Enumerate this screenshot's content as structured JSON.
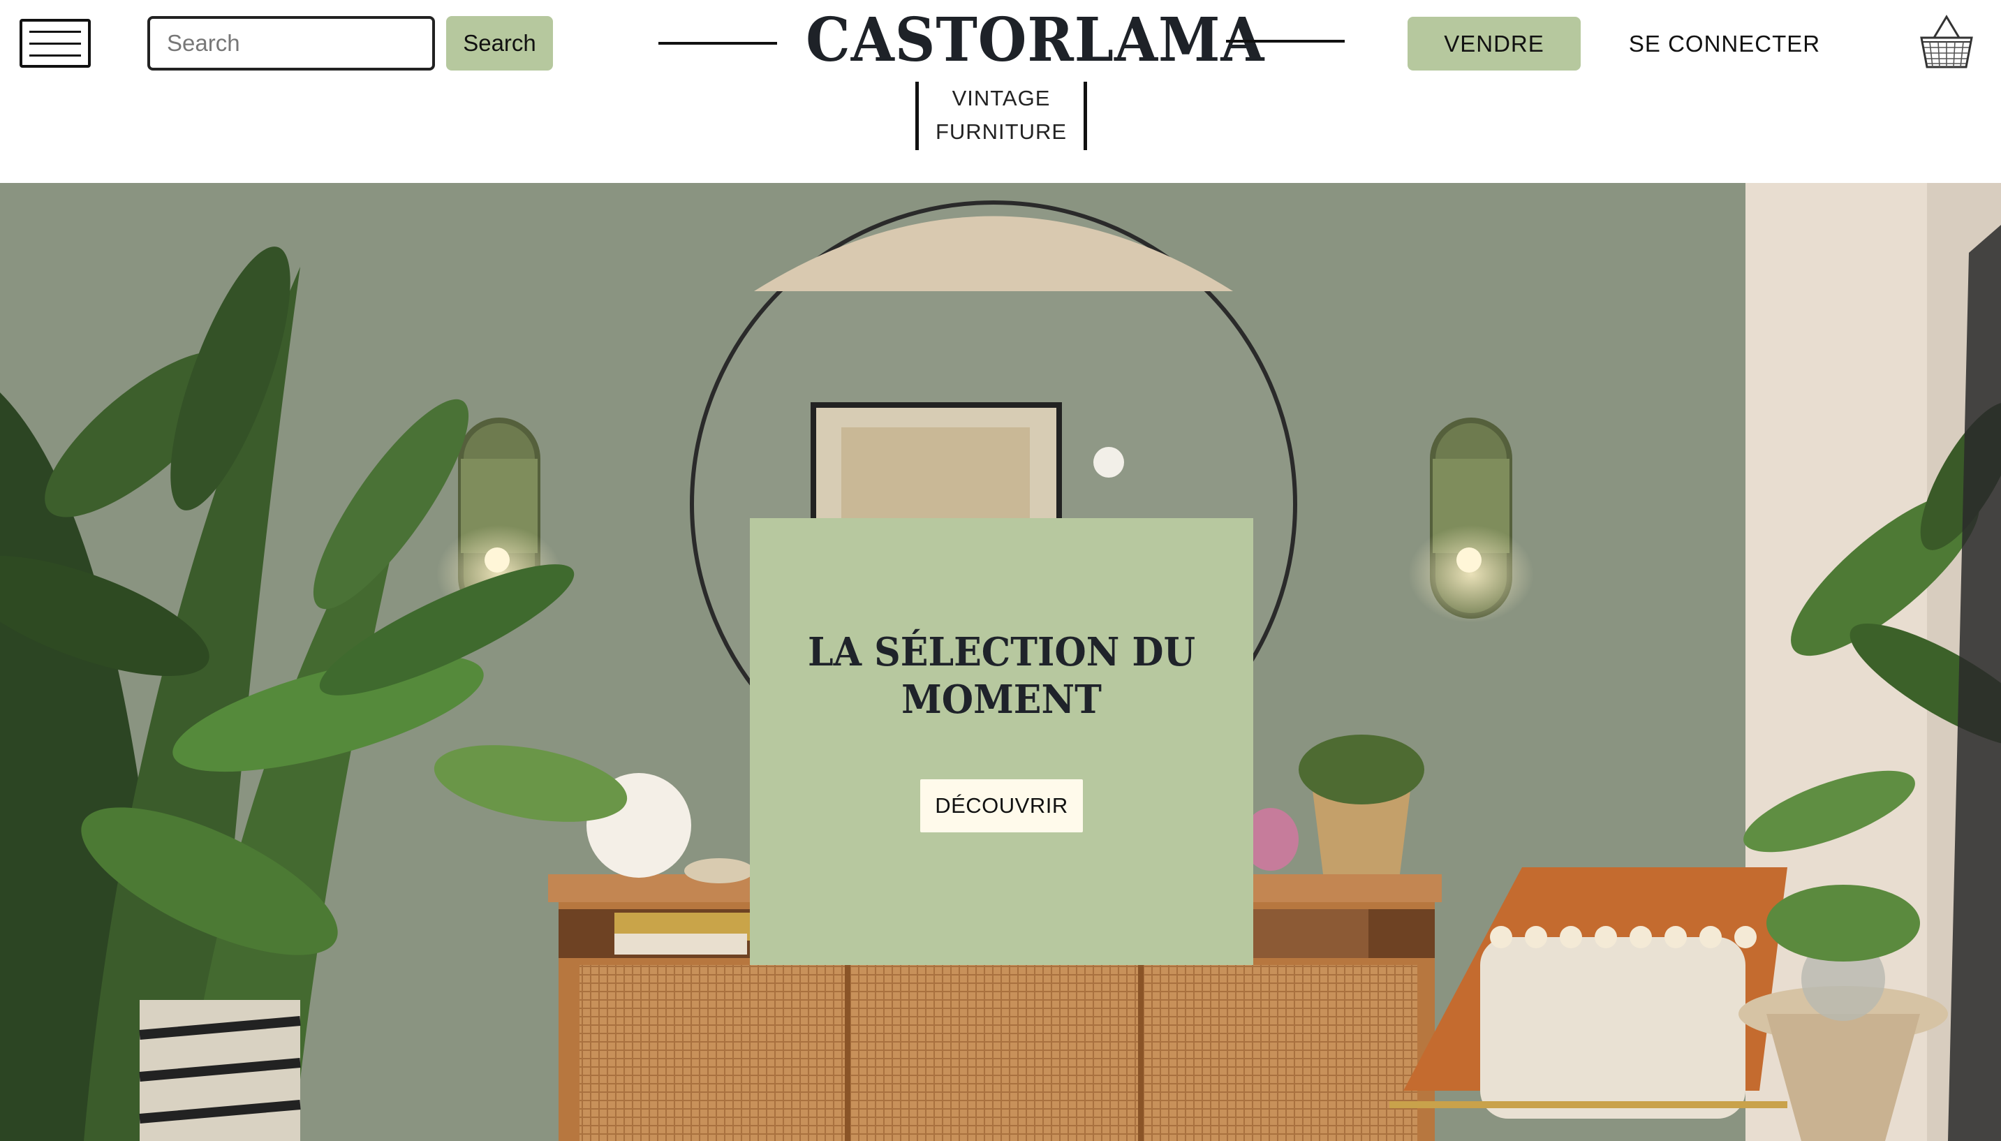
{
  "header": {
    "search": {
      "placeholder": "Search",
      "value": ""
    },
    "search_button_label": "Search",
    "brand": {
      "title": "CASTORLAMA",
      "subtitle_line1": "VINTAGE",
      "subtitle_line2": "FURNITURE"
    },
    "sell_button_label": "VENDRE",
    "login_label": "SE CONNECTER",
    "icons": {
      "menu": "hamburger-menu-icon",
      "cart": "basket-icon"
    }
  },
  "hero": {
    "promo_title": "LA SÉLECTION DU MOMENT",
    "discover_label": "DÉCOUVRIR"
  },
  "colors": {
    "accent_green": "#b6c89e",
    "card_green": "#b7c89f",
    "discover_button_bg": "#fffaeb",
    "text_dark": "#1e2228"
  }
}
